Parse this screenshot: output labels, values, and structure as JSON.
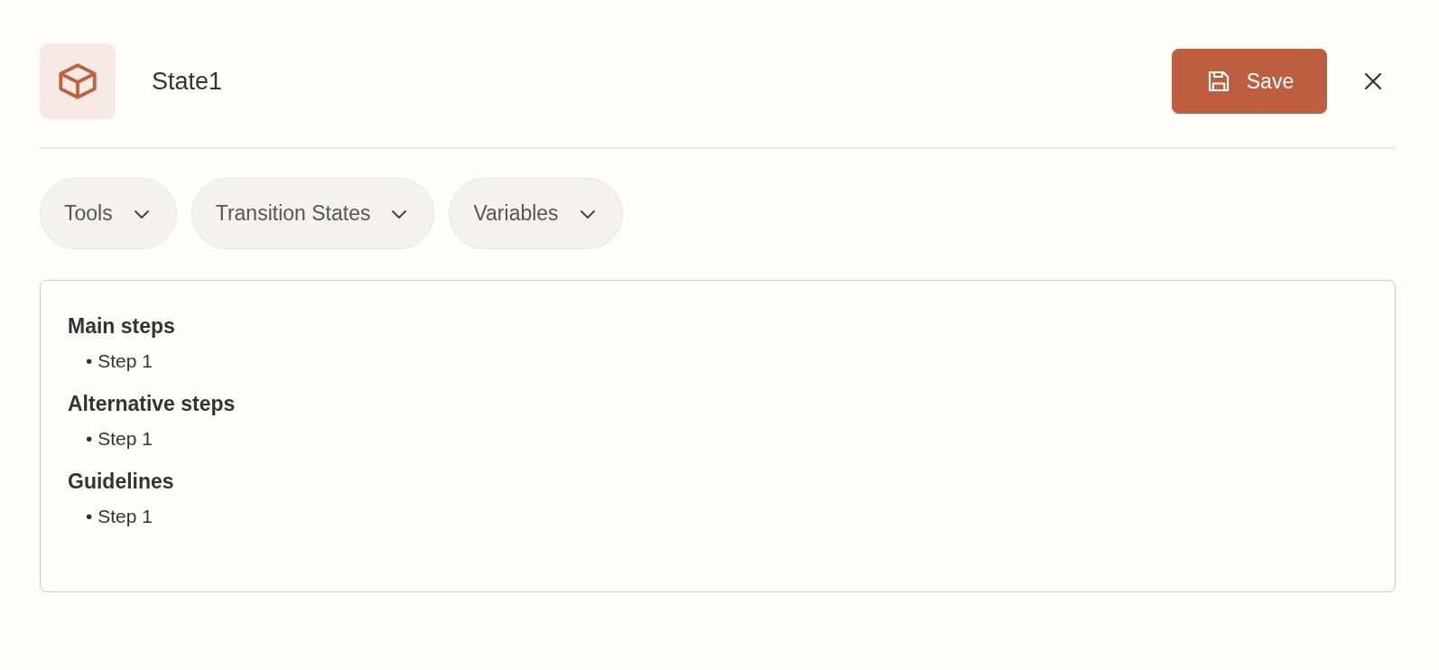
{
  "header": {
    "title": "State1",
    "save_label": "Save"
  },
  "chips": [
    {
      "label": "Tools",
      "expanded": false
    },
    {
      "label": "Transition States",
      "expanded": false
    },
    {
      "label": "Variables",
      "expanded": false
    }
  ],
  "sections": [
    {
      "heading": "Main steps",
      "items": [
        "• Step 1"
      ]
    },
    {
      "heading": "Alternative steps",
      "items": [
        "• Step 1"
      ]
    },
    {
      "heading": "Guidelines",
      "items": [
        "• Step 1"
      ]
    }
  ]
}
